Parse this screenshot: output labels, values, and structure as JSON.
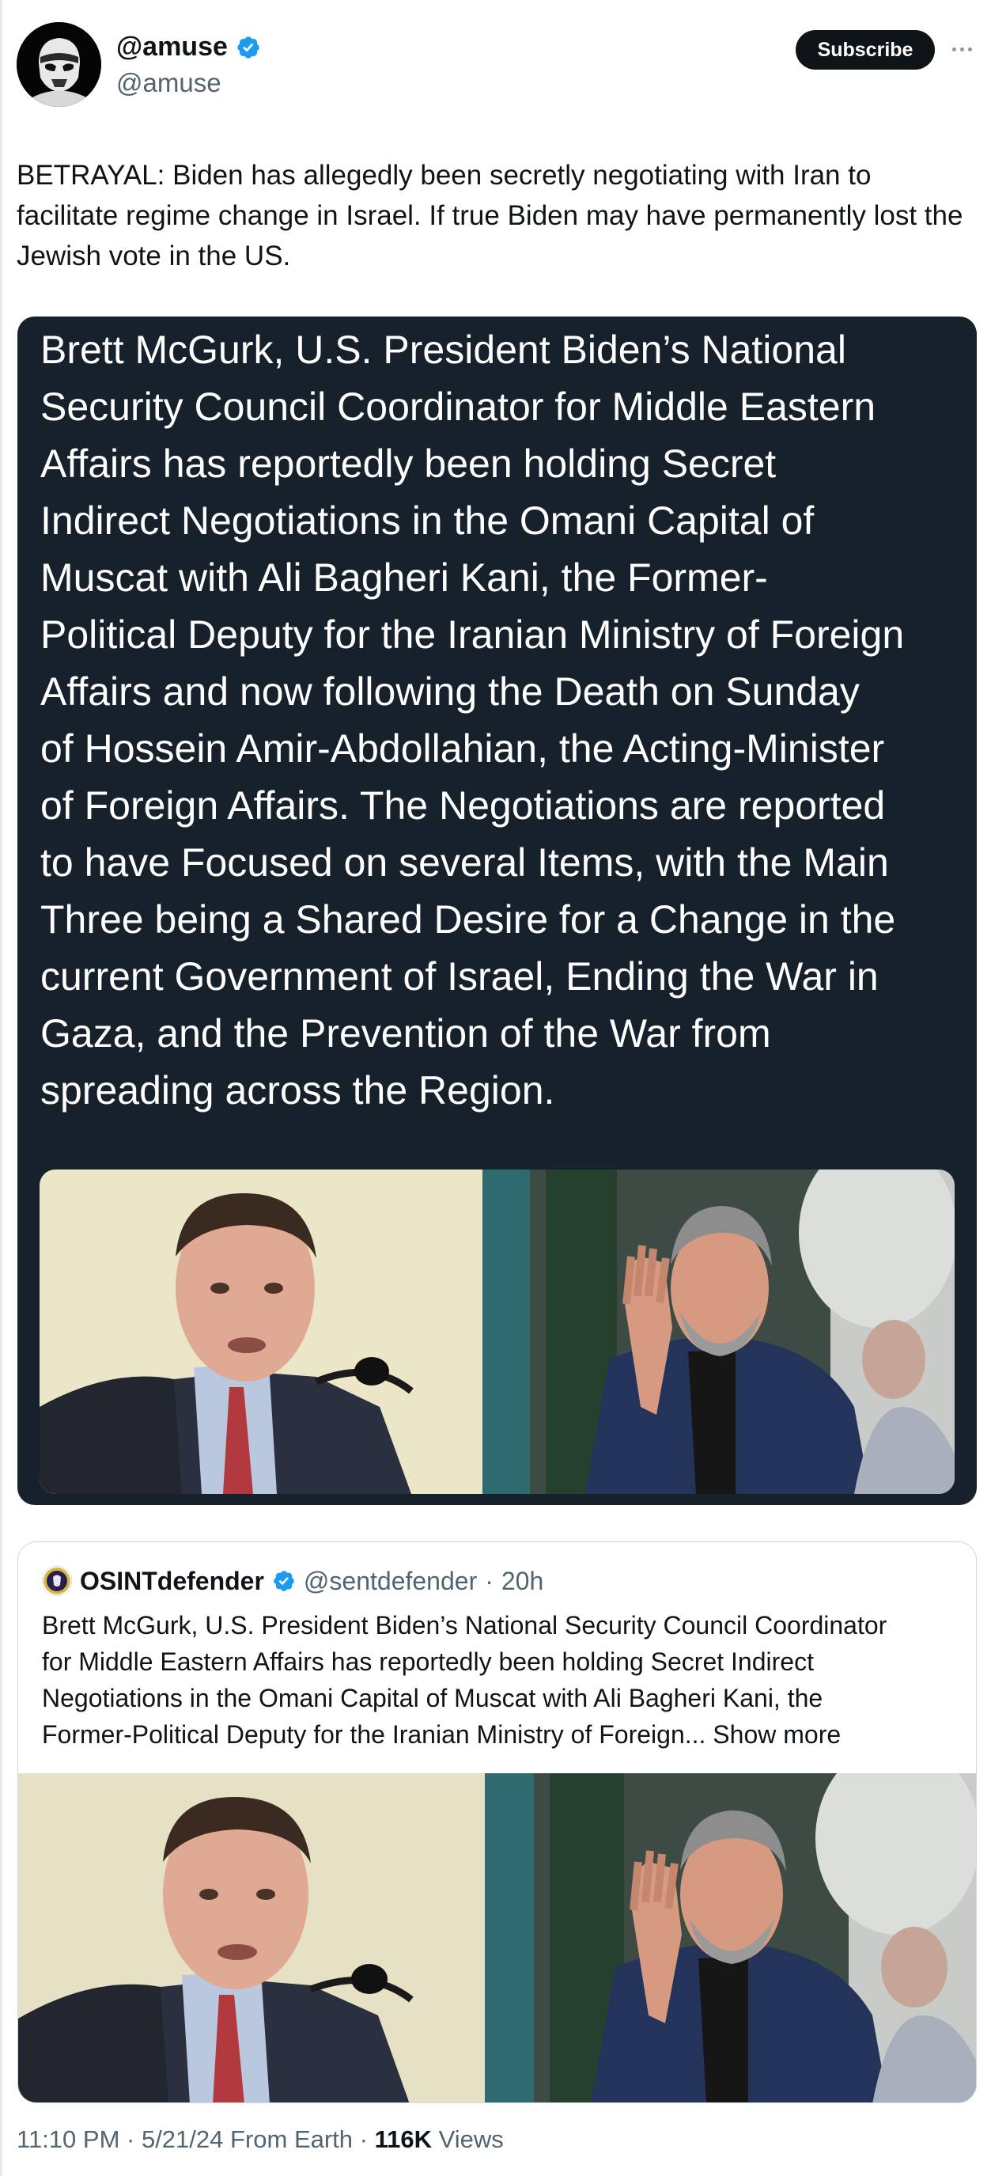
{
  "author": {
    "display_name": "@amuse",
    "handle": "@amuse",
    "verified": true,
    "avatar_icon": "stormtrooper-avatar"
  },
  "actions": {
    "subscribe_label": "Subscribe",
    "more_icon": "more-horizontal-icon"
  },
  "tweet": {
    "text": "BETRAYAL: Biden has allegedly been secretly negotiating with Iran to facilitate regime change in Israel. If true Biden may have permanently lost the Jewish vote in the US."
  },
  "image_card": {
    "text_lines": [
      "Brett McGurk, U.S. President Biden’s National",
      "Security Council Coordinator for Middle Eastern",
      "Affairs has reportedly been holding Secret",
      "Indirect Negotiations in the Omani Capital of",
      "Muscat with Ali Bagheri Kani, the Former-",
      "Political Deputy for the Iranian Ministry of Foreign",
      "Affairs and now following the Death on Sunday",
      "of Hossein Amir-Abdollahian, the Acting-Minister",
      "of Foreign Affairs. The Negotiations are reported",
      "to have Focused on several Items, with the Main",
      "Three being a Shared Desire for a Change in the",
      "current Government of Israel, Ending the War in",
      "Gaza, and the Prevention of the War from",
      "spreading across the Region."
    ],
    "background": "#17212c"
  },
  "quote": {
    "name": "OSINTdefender",
    "handle": "@sentdefender",
    "separator": "·",
    "time": "20h",
    "verified": true,
    "text_lines": [
      "Brett McGurk, U.S. President Biden’s National Security Council Coordinator",
      "for Middle Eastern Affairs has reportedly been holding Secret Indirect",
      "Negotiations in the Omani Capital of Muscat with Ali Bagheri Kani, the",
      "Former-Political Deputy for the Iranian Ministry of Foreign..."
    ],
    "show_more": "Show more"
  },
  "footer": {
    "time": "11:10 PM",
    "sep1": " · ",
    "date": "5/21/24",
    "source": " From Earth",
    "sep2": " · ",
    "views_count": "116K",
    "views_label": " Views"
  },
  "colors": {
    "verified_blue": "#1d9bf0",
    "text_primary": "#0f1419",
    "text_secondary": "#536471",
    "card_dark": "#17212c",
    "subscribe_bg": "#0f1419"
  }
}
